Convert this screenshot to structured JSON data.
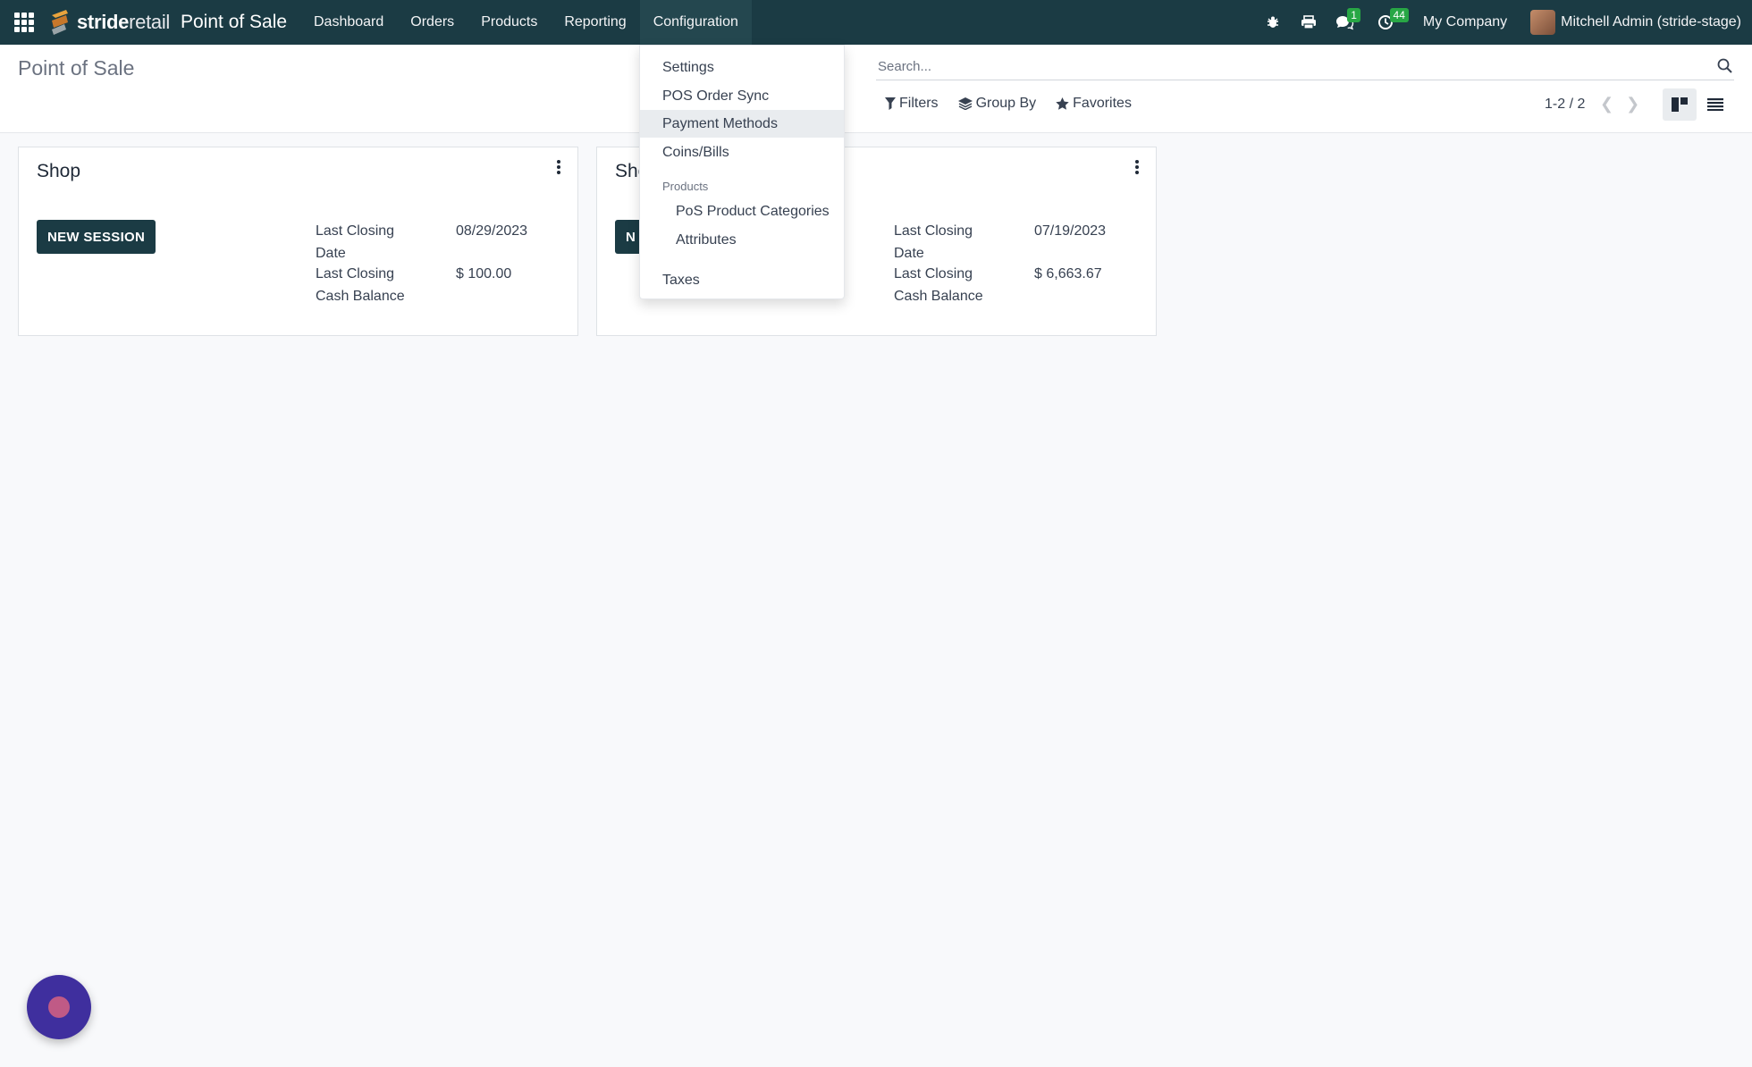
{
  "navbar": {
    "brand_bold": "stride",
    "brand_light": "retail",
    "app_name": "Point of Sale",
    "menu": [
      {
        "label": "Dashboard"
      },
      {
        "label": "Orders"
      },
      {
        "label": "Products"
      },
      {
        "label": "Reporting"
      },
      {
        "label": "Configuration"
      }
    ],
    "messages_badge": "1",
    "activities_badge": "44",
    "company": "My Company",
    "user": "Mitchell Admin (stride-stage)"
  },
  "control": {
    "title": "Point of Sale",
    "search_placeholder": "Search...",
    "filters_label": "Filters",
    "group_by_label": "Group By",
    "favorites_label": "Favorites",
    "pager": "1-2 / 2"
  },
  "cards": [
    {
      "title": "Shop",
      "button": "NEW SESSION",
      "closing_date_label_1": "Last Closing",
      "closing_date_label_2": "Date",
      "closing_date": "08/29/2023",
      "cash_label_1": "Last Closing",
      "cash_label_2": "Cash Balance",
      "cash": "$ 100.00"
    },
    {
      "title": "Sho",
      "button": "N",
      "closing_date_label_1": "Last Closing",
      "closing_date_label_2": "Date",
      "closing_date": "07/19/2023",
      "cash_label_1": "Last Closing",
      "cash_label_2": "Cash Balance",
      "cash": "$ 6,663.67"
    }
  ],
  "dropdown": {
    "settings": "Settings",
    "pos_order_sync": "POS Order Sync",
    "payment_methods": "Payment Methods",
    "coins_bills": "Coins/Bills",
    "products_header": "Products",
    "pos_product_categories": "PoS Product Categories",
    "attributes": "Attributes",
    "taxes": "Taxes"
  },
  "colors": {
    "navbar": "#1b3b44",
    "primary_button": "#1b3b44",
    "badge": "#28a745",
    "fab": "#3f2f9e"
  }
}
